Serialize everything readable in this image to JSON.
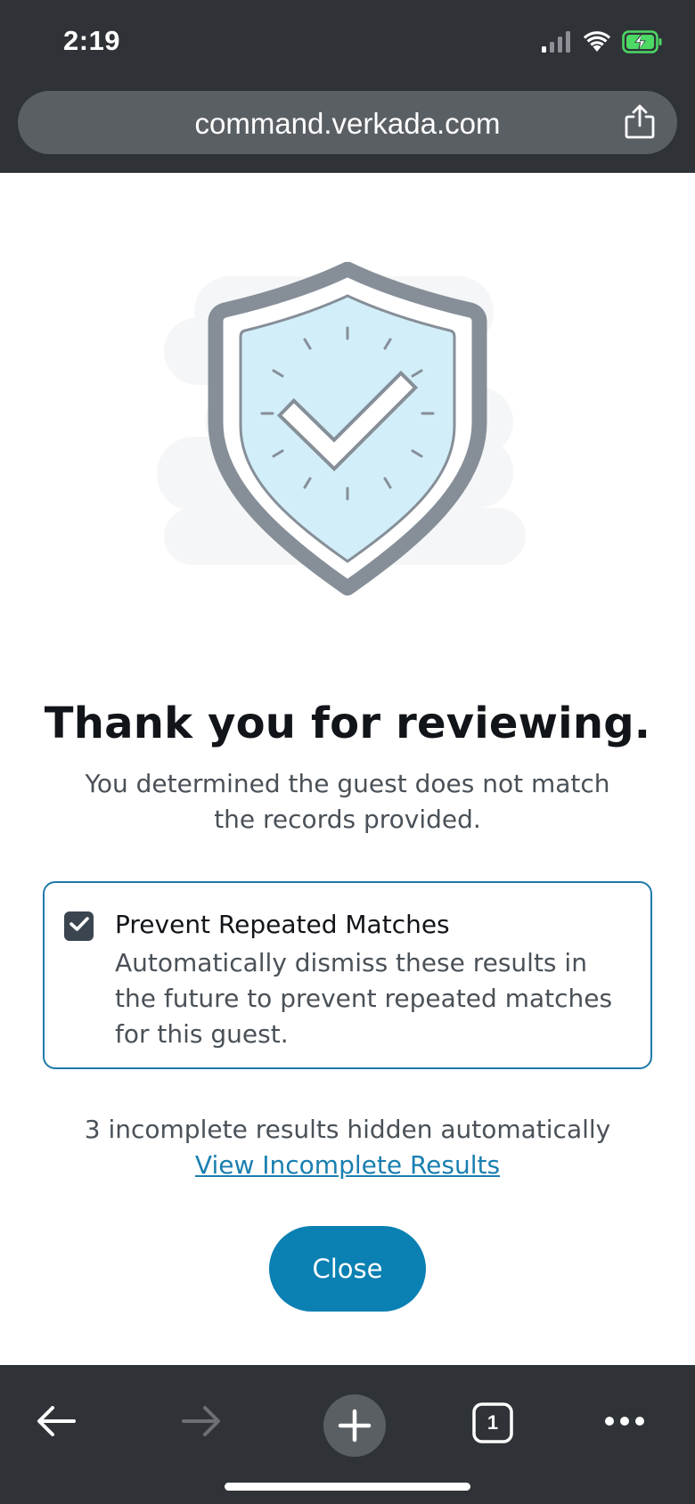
{
  "status_bar": {
    "time": "2:19",
    "icons": [
      "signal-icon",
      "wifi-icon",
      "battery-charging-icon"
    ]
  },
  "browser": {
    "url": "command.verkada.com",
    "share_icon": "share-icon"
  },
  "illustration": {
    "icon": "shield-check-clock-illustration"
  },
  "main": {
    "title": "Thank you for reviewing.",
    "subtitle": "You determined the guest does not match the records provided."
  },
  "option": {
    "checked": true,
    "title": "Prevent Repeated Matches",
    "description": "Automatically dismiss these results in the future to prevent repeated matches for this guest."
  },
  "hidden_results": {
    "note": "3 incomplete results hidden automatically",
    "link": "View Incomplete Results"
  },
  "actions": {
    "close_label": "Close"
  },
  "toolbar": {
    "tab_count": "1",
    "icons": [
      "back-arrow-icon",
      "forward-arrow-icon",
      "new-tab-plus-icon",
      "tabs-icon",
      "more-icon"
    ]
  },
  "colors": {
    "chrome_bg": "#2f3338",
    "url_bar_bg": "#5a5f64",
    "accent": "#0a80b3",
    "card_border": "#1f7aa8",
    "checkbox": "#3a4550",
    "shield_fill": "#d2eef9",
    "shield_stroke": "#868f98",
    "battery_green": "#4cd964"
  }
}
